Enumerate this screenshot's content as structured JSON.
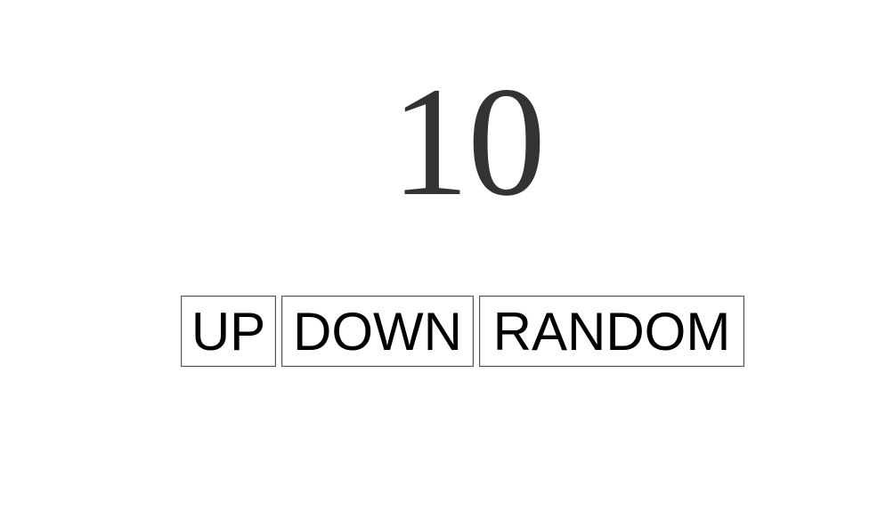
{
  "counter": {
    "value": "10"
  },
  "buttons": {
    "up_label": "UP",
    "down_label": "DOWN",
    "random_label": "RANDOM"
  },
  "colors": {
    "counter_text": "#333333",
    "button_border": "#555555",
    "button_text": "#000000",
    "background": "#ffffff"
  }
}
